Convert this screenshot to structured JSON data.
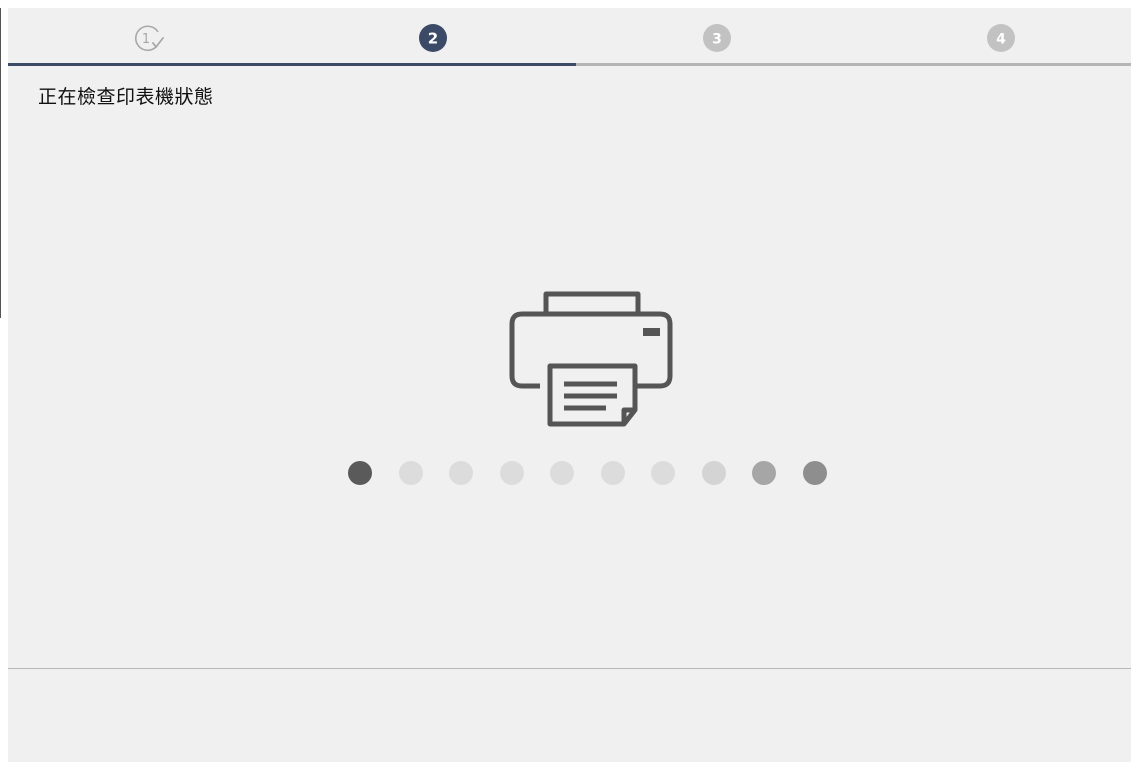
{
  "steps": [
    {
      "number": "1",
      "state": "completed",
      "icon": "check-circle-icon"
    },
    {
      "number": "2",
      "state": "current"
    },
    {
      "number": "3",
      "state": "pending"
    },
    {
      "number": "4",
      "state": "pending"
    }
  ],
  "status": {
    "title": "正在檢查印表機狀態"
  },
  "illustration": {
    "icon": "printer-icon"
  },
  "progress": {
    "dot_count": 10,
    "dot_colors": [
      "#5a5a5a",
      "#dcdcdc",
      "#dcdcdc",
      "#dcdcdc",
      "#dcdcdc",
      "#dcdcdc",
      "#dcdcdc",
      "#d4d4d4",
      "#a6a6a6",
      "#8e8e8e"
    ]
  },
  "colors": {
    "active_step": "#3b4a66",
    "inactive_step": "#c2c2c2",
    "background": "#f0f0f0",
    "icon_stroke": "#555555"
  }
}
